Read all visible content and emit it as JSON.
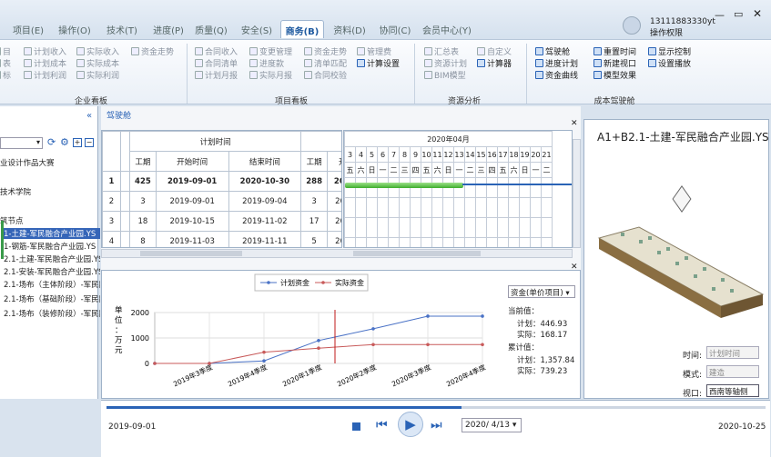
{
  "tabs": [
    "项目(E)",
    "操作(O)",
    "技术(T)",
    "进度(P)",
    "质量(Q)",
    "安全(S)",
    "商务(B)",
    "资料(D)",
    "协同(C)",
    "会员中心(Y)"
  ],
  "active_tab": "商务(B)",
  "user": {
    "name": "13111883330yt",
    "role": "操作权限"
  },
  "ribbon": {
    "enterprise": {
      "col1": [
        "目",
        "表",
        "标"
      ],
      "col2": [
        "计划收入",
        "计划成本",
        "计划利润"
      ],
      "col3": [
        "实际收入",
        "实际成本",
        "实际利润"
      ],
      "col4": [
        "资金走势"
      ],
      "group": "企业看板"
    },
    "project": {
      "col1": [
        "合同收入",
        "合同清单",
        "计划月报"
      ],
      "col2": [
        "变更管理",
        "进度款",
        "实际月报"
      ],
      "col3": [
        "资金走势",
        "清单匹配",
        "合同校验"
      ],
      "col4": [
        "管理费",
        "计算设置"
      ],
      "group": "项目看板"
    },
    "resource": {
      "col1": [
        "汇总表",
        "资源计划",
        "BIM模型"
      ],
      "col2": [
        "自定义",
        "计算器"
      ],
      "group": "资源分析"
    },
    "cost": {
      "col1": [
        "驾驶舱",
        "进度计划",
        "资金曲线"
      ],
      "col2": [
        "重置时间",
        "新建视口",
        "模型效果"
      ],
      "col3": [
        "显示控制",
        "设置播放"
      ],
      "group": "成本驾驶舱"
    }
  },
  "panel_tab": "驾驶舱",
  "tree": [
    "业设计作品大赛",
    "",
    "技术学院",
    "",
    "筑节点",
    "1-土建-军民融合产业园.YS",
    "1-钢筋-军民融合产业园.YS",
    "2.1-土建-军民融合产业园.YS",
    "2.1-安装-军民融合产业园.YS",
    "2.1-场布（主体阶段）-军民融",
    "2.1-场布（基础阶段）-军民融",
    "2.1-场布（装修阶段）-军民融"
  ],
  "table": {
    "group_header": "计划时间",
    "headers": [
      "工期",
      "开始时间",
      "结束时间",
      "工期",
      "开始"
    ],
    "rows": [
      {
        "n": "1",
        "d": "425",
        "s": "2019-09-01",
        "e": "2020-10-30",
        "d2": "288",
        "s2": "2019-"
      },
      {
        "n": "2",
        "d": "3",
        "s": "2019-09-01",
        "e": "2019-09-04",
        "d2": "3",
        "s2": "2019-"
      },
      {
        "n": "3",
        "d": "18",
        "s": "2019-10-15",
        "e": "2019-11-02",
        "d2": "17",
        "s2": "2019-"
      },
      {
        "n": "4",
        "d": "8",
        "s": "2019-11-03",
        "e": "2019-11-11",
        "d2": "5",
        "s2": "2019-"
      }
    ]
  },
  "gantt": {
    "month": "2020年04月",
    "days": [
      "3",
      "4",
      "5",
      "6",
      "7",
      "8",
      "9",
      "10",
      "11",
      "12",
      "13",
      "14",
      "15",
      "16",
      "17",
      "18",
      "19",
      "20",
      "21"
    ],
    "weekdays": [
      "五",
      "六",
      "日",
      "一",
      "二",
      "三",
      "四",
      "五",
      "六",
      "日",
      "一",
      "二",
      "三",
      "四",
      "五",
      "六",
      "日",
      "一",
      "二"
    ]
  },
  "chart_data": {
    "type": "line",
    "categories": [
      "2019年3季度",
      "2019年4季度",
      "2020年1季度",
      "2020年2季度",
      "2020年3季度",
      "2020年4季度"
    ],
    "series": [
      {
        "name": "计划资金",
        "color": "#4a72c6",
        "values": [
          0,
          0,
          100,
          900,
          1360,
          1858,
          1858
        ]
      },
      {
        "name": "实际资金",
        "color": "#c85a5a",
        "values": [
          0,
          0,
          440,
          600,
          740,
          740,
          740
        ]
      }
    ],
    "x_all": [
      "",
      "2019年3季度",
      "2019年4季度",
      "2020年1季度",
      "2020年2季度",
      "2020年3季度",
      "2020年4季度"
    ],
    "ylabel": "单位：万元",
    "ylim": [
      0,
      2000
    ],
    "yticks": [
      "0",
      "1000",
      "2000"
    ],
    "marker_label": "2020/4/13"
  },
  "money_select": "资金(单价项目)",
  "stats": {
    "cur_label": "当前值：",
    "cur_plan": "计划：446.93",
    "cur_act": "实际：168.17",
    "acc_label": "累计值：",
    "acc_plan": "计划：1,357.84",
    "acc_act": "实际：739.23"
  },
  "model": {
    "title": "A1+B2.1-土建-军民融合产业园.YS",
    "time_label": "时间:",
    "time_val": "计划时间",
    "mode_label": "模式:",
    "mode_val": "建造",
    "view_label": "视口:",
    "view_val": "西南等轴侧"
  },
  "timeline": {
    "start": "2019-09-01",
    "end": "2020-10-25",
    "current": "2020/ 4/13"
  }
}
